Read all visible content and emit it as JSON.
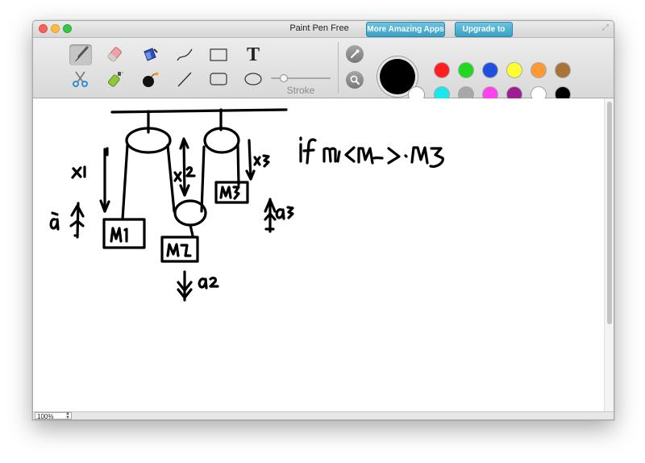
{
  "window": {
    "title": "Paint Pen Free",
    "buttons": {
      "more_apps": "More Amazing Apps",
      "upgrade": "Upgrade to Pro"
    }
  },
  "tools": [
    {
      "name": "brush",
      "icon": "paintbrush-icon",
      "selected": true
    },
    {
      "name": "eraser",
      "icon": "eraser-icon"
    },
    {
      "name": "fill",
      "icon": "paint-bucket-icon"
    },
    {
      "name": "curve",
      "icon": "curve-icon"
    },
    {
      "name": "rectangle",
      "icon": "rectangle-icon"
    },
    {
      "name": "text",
      "icon": "text-icon",
      "glyph": "T"
    },
    {
      "name": "cut",
      "icon": "scissors-icon"
    },
    {
      "name": "spray",
      "icon": "spray-can-icon"
    },
    {
      "name": "bomb",
      "icon": "bomb-icon"
    },
    {
      "name": "line",
      "icon": "line-icon"
    },
    {
      "name": "rounded-rectangle",
      "icon": "rounded-rectangle-icon"
    },
    {
      "name": "ellipse",
      "icon": "ellipse-icon"
    }
  ],
  "stroke": {
    "label": "Stroke",
    "value_fraction": 0.2
  },
  "colors": {
    "primary": "#000000",
    "secondary": "#ffffff",
    "palette": [
      "#ff1f1f",
      "#1ed91e",
      "#1f4fe0",
      "#ffff33",
      "#ff9933",
      "#a87437",
      "#19e8f0",
      "#a8a8a8",
      "#ff44ee",
      "#9b1f93",
      "#ffffff",
      "#000000"
    ]
  },
  "drawing": {
    "labels": [
      "x1",
      "x2",
      "x3",
      "a1",
      "a2",
      "a3",
      "M1",
      "M2",
      "M3",
      "if m1<m2 > m3"
    ]
  },
  "status": {
    "zoom": "100%"
  }
}
